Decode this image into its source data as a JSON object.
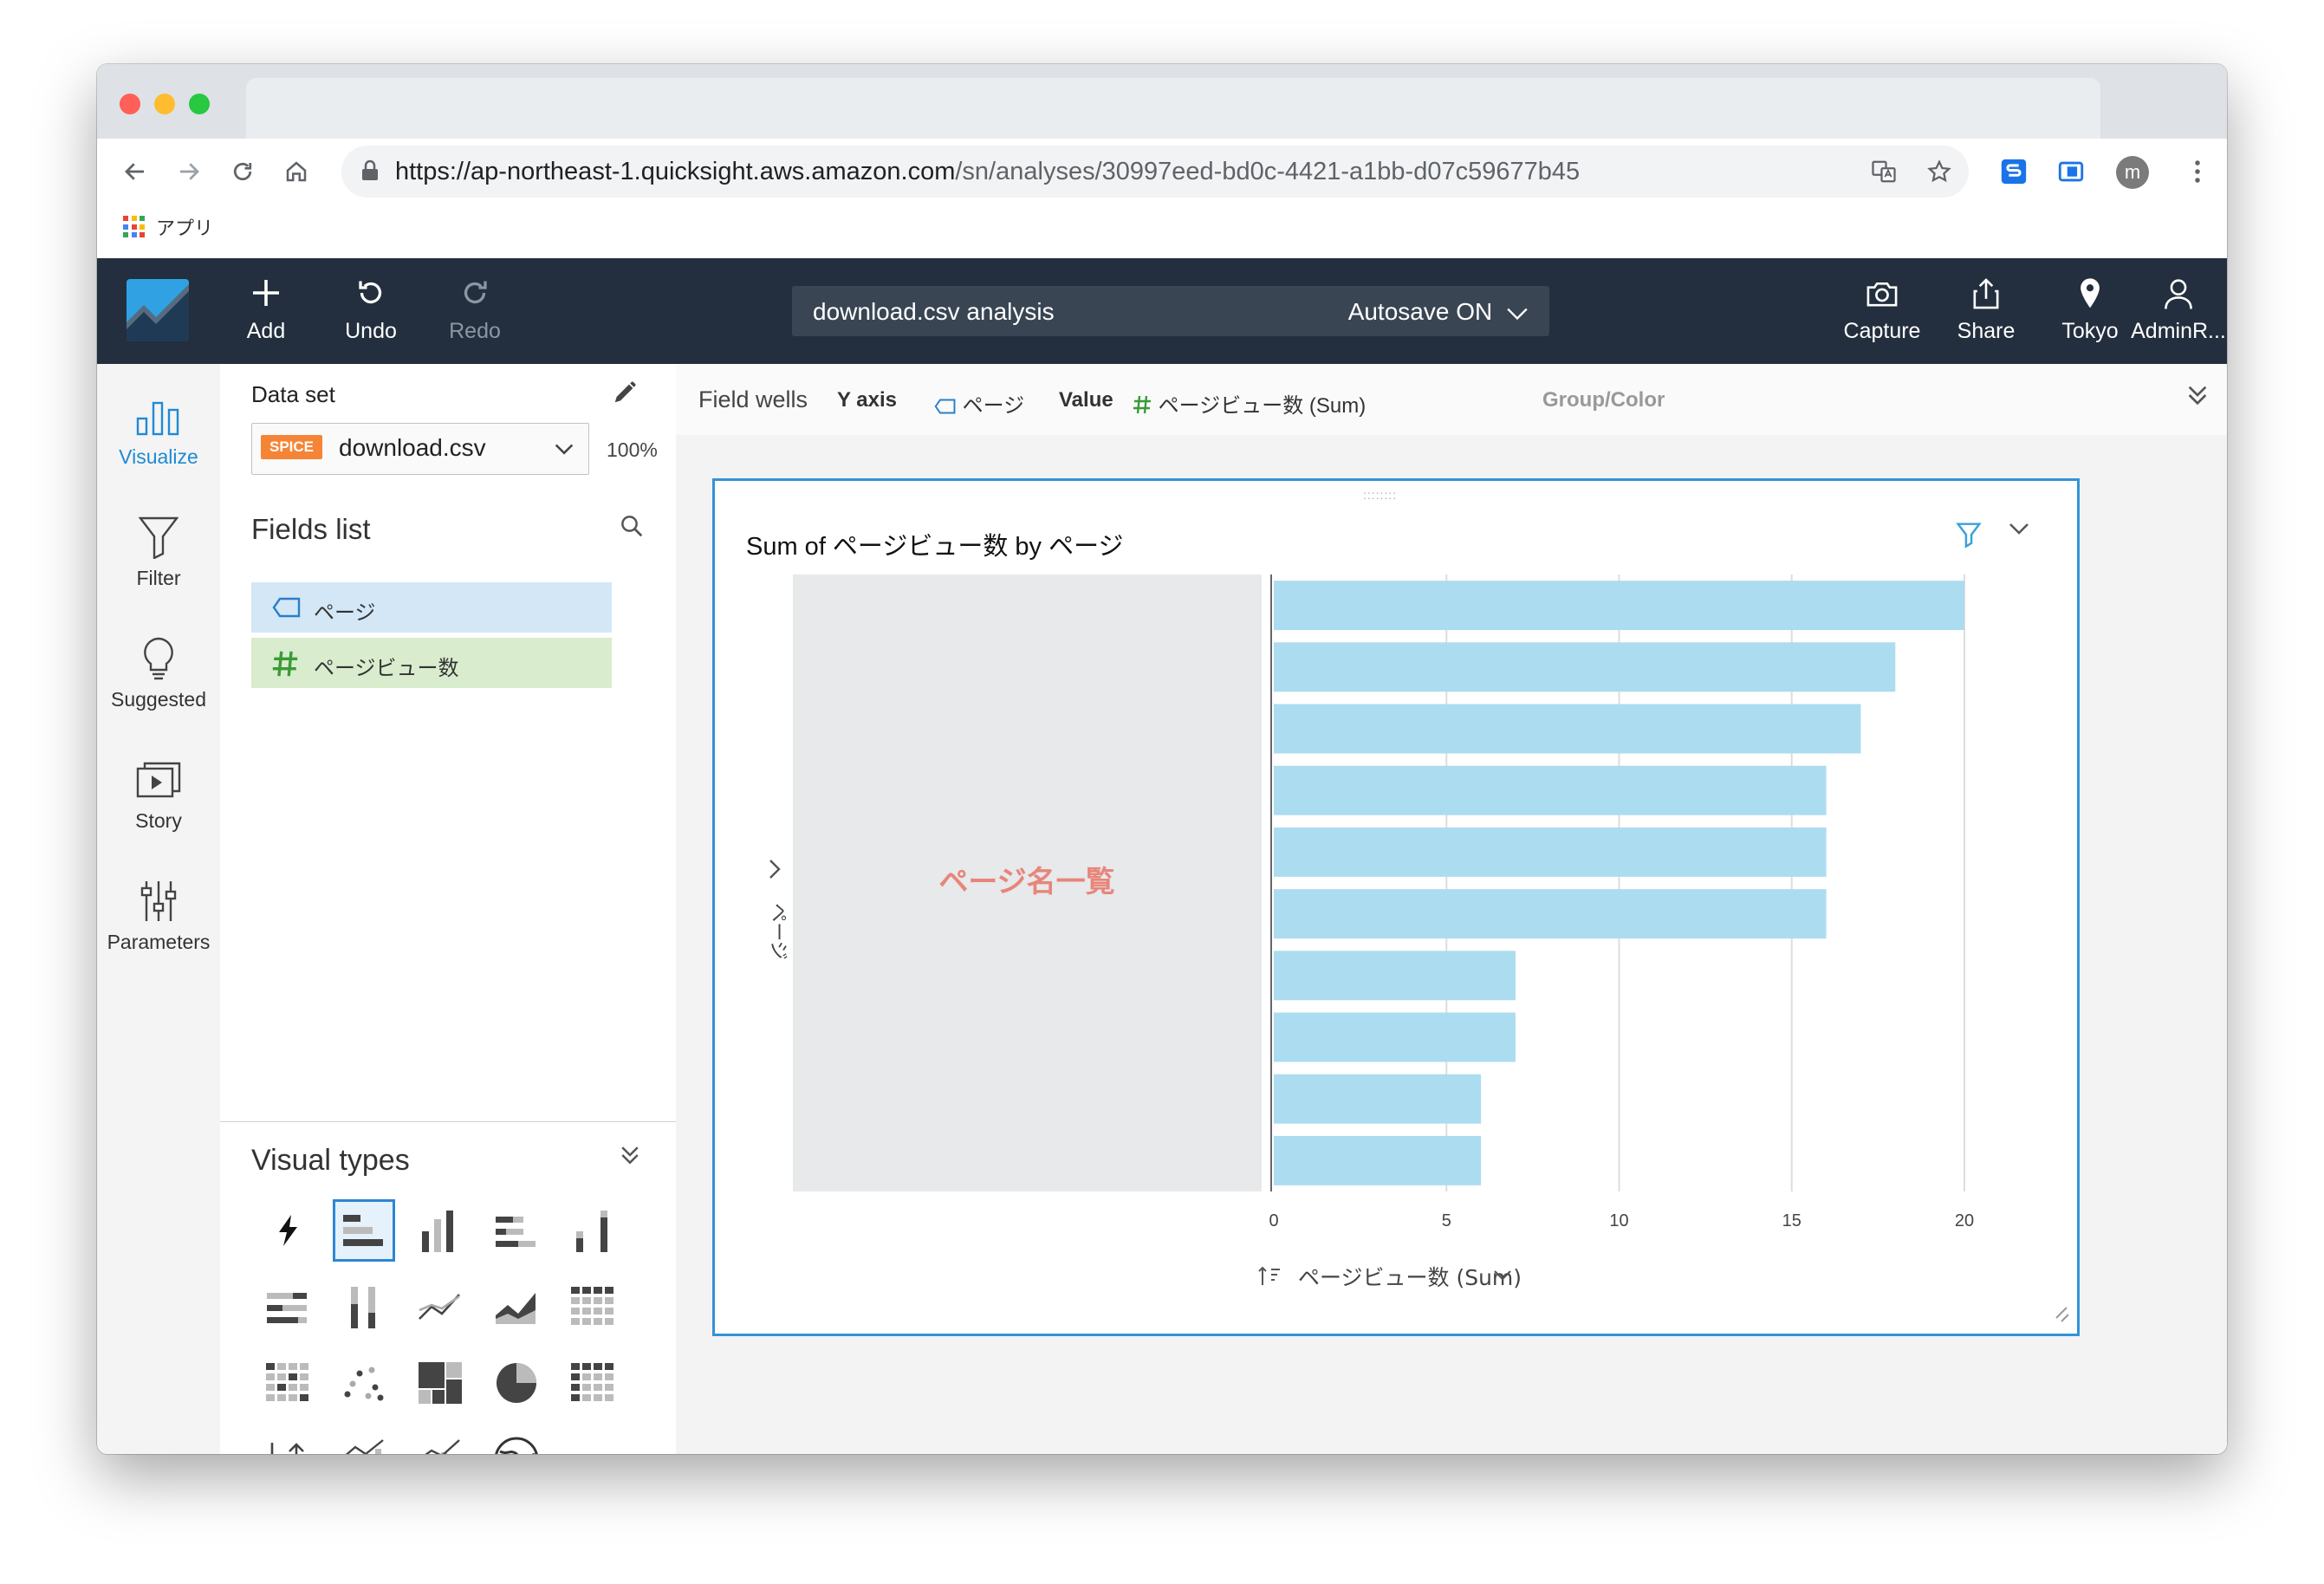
{
  "browser": {
    "url_host": "https://ap-northeast-1.quicksight.aws.amazon.com",
    "url_path": "/sn/analyses/30997eed-bd0c-4421-a1bb-d07c59677b45",
    "bookmark_apps": "アプリ",
    "avatar_letter": "m"
  },
  "header": {
    "add": "Add",
    "undo": "Undo",
    "redo": "Redo",
    "analysis_name": "download.csv analysis",
    "autosave": "Autosave ON",
    "capture": "Capture",
    "share": "Share",
    "region": "Tokyo",
    "user": "AdminR..."
  },
  "rail": {
    "visualize": "Visualize",
    "filter": "Filter",
    "suggested": "Suggested",
    "story": "Story",
    "parameters": "Parameters"
  },
  "panel": {
    "dataset_label": "Data set",
    "spice_badge": "SPICE",
    "dataset_name": "download.csv",
    "percent": "100%",
    "fields_title": "Fields list",
    "fields": [
      {
        "label": "ページ",
        "kind": "dimension"
      },
      {
        "label": "ページビュー数",
        "kind": "measure"
      }
    ],
    "visual_types_title": "Visual types"
  },
  "wells": {
    "title": "Field wells",
    "y_axis_label": "Y axis",
    "y_axis_value": "ページ",
    "value_label": "Value",
    "value_value": "ページビュー数 (Sum)",
    "group_color": "Group/Color"
  },
  "visual": {
    "title": "Sum of ページビュー数 by ページ",
    "overlay_text": "ページ名一覧",
    "y_axis_title": "ページ",
    "x_axis_title": "ページビュー数 (Sum)"
  },
  "chart_data": {
    "type": "bar",
    "orientation": "horizontal",
    "title": "Sum of ページビュー数 by ページ",
    "xlabel": "ページビュー数 (Sum)",
    "ylabel": "ページ",
    "xlim": [
      0,
      20
    ],
    "xticks": [
      0,
      5,
      10,
      15,
      20
    ],
    "values": [
      20,
      18,
      17,
      16,
      16,
      16,
      7,
      7,
      6,
      6
    ],
    "bar_color": "#acdcef",
    "grid": true
  },
  "colors": {
    "header_bg": "#232f3e",
    "accent": "#3293d8",
    "overlay_text": "#e8857a"
  }
}
